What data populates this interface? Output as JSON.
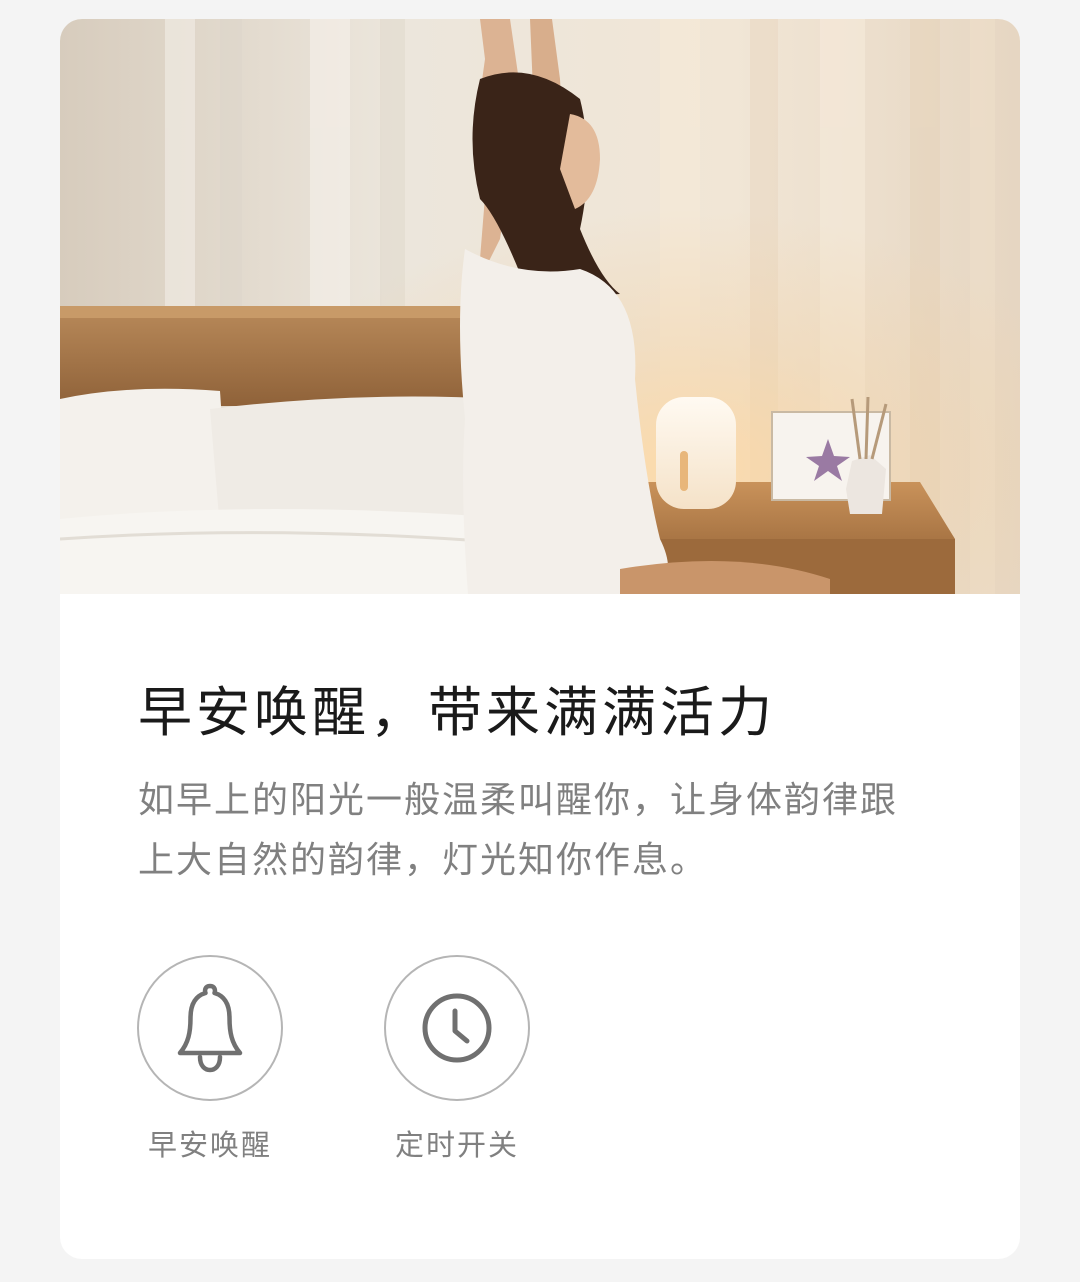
{
  "card": {
    "title": "早安唤醒，带来满满活力",
    "description": "如早上的阳光一般温柔叫醒你，让身体韵律跟上大自然的韵律，灯光知你作息。"
  },
  "features": [
    {
      "label": "早安唤醒",
      "icon": "bell-icon"
    },
    {
      "label": "定时开关",
      "icon": "clock-icon"
    }
  ],
  "colors": {
    "page_background": "#f4f4f4",
    "card_background": "#ffffff",
    "title_text": "#1a1a1a",
    "secondary_text": "#808080",
    "icon_stroke": "#707070",
    "circle_border": "#b5b5b5"
  }
}
